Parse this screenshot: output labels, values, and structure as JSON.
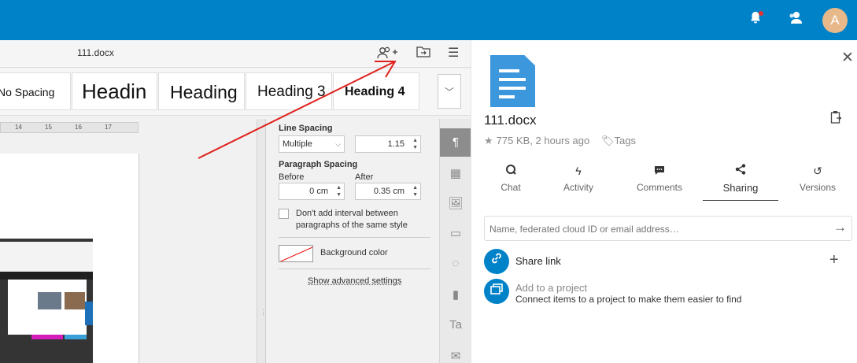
{
  "header": {
    "avatar_letter": "A",
    "brand_color": "#0082c9"
  },
  "editor": {
    "document_title": "111.docx",
    "header_icons": [
      "share-user-icon",
      "folder-icon",
      "menu-icon"
    ],
    "styles": [
      "No Spacing",
      "Headin",
      "Heading",
      "Heading 3",
      "Heading 4"
    ],
    "ruler_ticks": [
      "14",
      "15",
      "16",
      "17"
    ]
  },
  "paragraph_settings": {
    "line_spacing_label": "Line Spacing",
    "line_spacing_type": "Multiple",
    "line_spacing_value": "1.15",
    "paragraph_spacing_label": "Paragraph Spacing",
    "before_label": "Before",
    "before_value": "0 cm",
    "after_label": "After",
    "after_value": "0.35 cm",
    "no_interval_label": "Don't add interval between paragraphs of the same style",
    "background_color_label": "Background color",
    "advanced_link": "Show advanced settings"
  },
  "sidebar": {
    "file_name": "111.docx",
    "meta": "775 KB, 2 hours ago",
    "tags_label": "Tags",
    "tabs": [
      {
        "label": "Chat",
        "icon": "chat-icon"
      },
      {
        "label": "Activity",
        "icon": "activity-icon"
      },
      {
        "label": "Comments",
        "icon": "comments-icon"
      },
      {
        "label": "Sharing",
        "icon": "sharing-icon",
        "active": true
      },
      {
        "label": "Versions",
        "icon": "versions-icon"
      }
    ],
    "share_placeholder": "Name, federated cloud ID or email address…",
    "share_link_label": "Share link",
    "project_title": "Add to a project",
    "project_description": "Connect items to a project to make them easier to find"
  }
}
